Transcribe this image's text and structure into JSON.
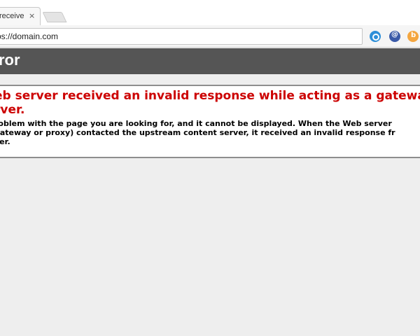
{
  "tab": {
    "title": "receive",
    "close": "×"
  },
  "toolbar": {
    "url": "ps://domain.com"
  },
  "extensions": [
    "at-sign-extension-icon",
    "at-extension-icon",
    "bitly-extension-icon"
  ],
  "header": {
    "title": "ror"
  },
  "error": {
    "heading": "eb server received an invalid response while acting as a gateway\nrver.",
    "body": "roblem with the page you are looking for, and it cannot be displayed. When the Web server\ngateway or proxy) contacted the upstream content server, it received an invalid response fr\nver."
  },
  "colors": {
    "header": "#555555",
    "heading": "#cc0000",
    "background": "#eeeeee"
  }
}
